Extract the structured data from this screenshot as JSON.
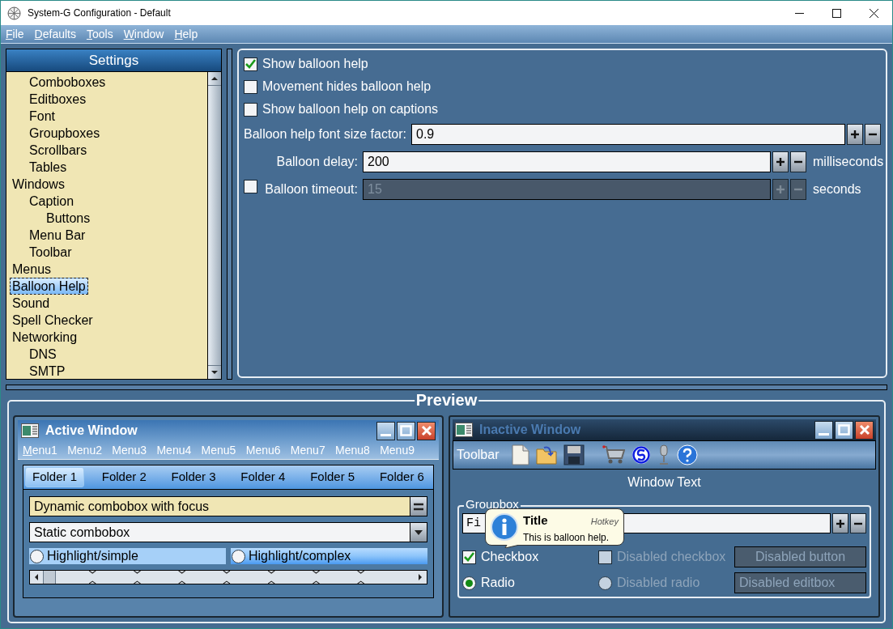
{
  "window": {
    "title": "System-G Configuration - Default"
  },
  "menu": [
    "File",
    "Defaults",
    "Tools",
    "Window",
    "Help"
  ],
  "settings": {
    "title": "Settings",
    "items": [
      {
        "children": [
          {
            "label": "Comboboxes",
            "selected": false
          },
          {
            "label": "Editboxes",
            "selected": false
          },
          {
            "label": "Font",
            "selected": false
          },
          {
            "label": "Groupboxes",
            "selected": false
          },
          {
            "label": "Scrollbars",
            "selected": false
          },
          {
            "label": "Tables",
            "selected": false
          }
        ]
      },
      {
        "label": "Windows",
        "selected": false,
        "children": [
          {
            "label": "Caption",
            "selected": false,
            "children": [
              {
                "label": "Buttons",
                "selected": false
              }
            ]
          },
          {
            "label": "Menu Bar",
            "selected": false
          },
          {
            "label": "Toolbar",
            "selected": false
          }
        ]
      },
      {
        "label": "Menus",
        "selected": false
      },
      {
        "label": "Balloon Help",
        "selected": true
      },
      {
        "label": "Sound",
        "selected": false
      },
      {
        "label": "Spell Checker",
        "selected": false
      },
      {
        "label": "Networking",
        "selected": false,
        "children": [
          {
            "label": "DNS",
            "selected": false
          },
          {
            "label": "SMTP",
            "selected": false
          }
        ]
      }
    ]
  },
  "options": [
    {
      "label": "Show balloon help",
      "checked": true
    },
    {
      "label": "Movement hides balloon help",
      "checked": false
    },
    {
      "label": "Show balloon help on captions",
      "checked": false
    }
  ],
  "fields": [
    {
      "label": "Balloon help font size factor:",
      "value": "0.9",
      "disabled": false
    },
    {
      "label": "Balloon delay:",
      "value": "200",
      "unit": "milliseconds",
      "disabled": false
    },
    {
      "label": "Balloon timeout:",
      "value": "15",
      "unit": "seconds",
      "disabled": true,
      "checkbox": {
        "checked": false
      }
    }
  ],
  "preview": {
    "title": "Preview",
    "active_window": {
      "title": "Active Window",
      "menus": [
        {
          "label": "Menu1",
          "underlined": true
        },
        {
          "label": "Menu2",
          "underlined": false
        },
        {
          "label": "Menu3",
          "underlined": false
        },
        {
          "label": "Menu4",
          "underlined": false
        },
        {
          "label": "Menu5",
          "underlined": false
        },
        {
          "label": "Menu6",
          "underlined": false
        },
        {
          "label": "Menu7",
          "underlined": false
        },
        {
          "label": "Menu8",
          "underlined": false
        },
        {
          "label": "Menu9",
          "underlined": false
        }
      ],
      "tabs": [
        {
          "label": "Folder 1",
          "selected": true
        },
        {
          "label": "Folder 2",
          "selected": false
        },
        {
          "label": "Folder 3",
          "selected": false
        },
        {
          "label": "Folder 4",
          "selected": false
        },
        {
          "label": "Folder 5",
          "selected": false
        },
        {
          "label": "Folder 6",
          "selected": false
        }
      ],
      "combos": [
        {
          "kind": "dynamic",
          "value": "Dynamic combobox with focus",
          "focused": true
        },
        {
          "kind": "static",
          "value": "Static combobox",
          "focused": false
        }
      ],
      "radios": [
        {
          "label": "Highlight/simple",
          "selected": false,
          "kind": "simple"
        },
        {
          "label": "Highlight/complex",
          "selected": false,
          "kind": "complex"
        }
      ]
    },
    "inactive_window": {
      "title": "Inactive Window",
      "toolbar_label": "Toolbar",
      "window_text": "Window Text",
      "groupbox": {
        "label": "Groupbox",
        "field_value": "Fi",
        "controls": [
          {
            "kind": "checkbox",
            "label": "Checkbox",
            "checked": true,
            "disabled": false
          },
          {
            "kind": "checkbox",
            "label": "Disabled checkbox",
            "checked": false,
            "disabled": true
          },
          {
            "kind": "button",
            "label": "Disabled button",
            "disabled": true
          },
          {
            "kind": "radio",
            "label": "Radio",
            "selected": true,
            "disabled": false
          },
          {
            "kind": "radio",
            "label": "Disabled radio",
            "selected": false,
            "disabled": true
          },
          {
            "kind": "editbox",
            "value": "Disabled editbox",
            "disabled": true
          }
        ]
      },
      "balloon": {
        "title": "Title",
        "hotkey": "Hotkey",
        "text": "This is balloon help."
      }
    }
  }
}
